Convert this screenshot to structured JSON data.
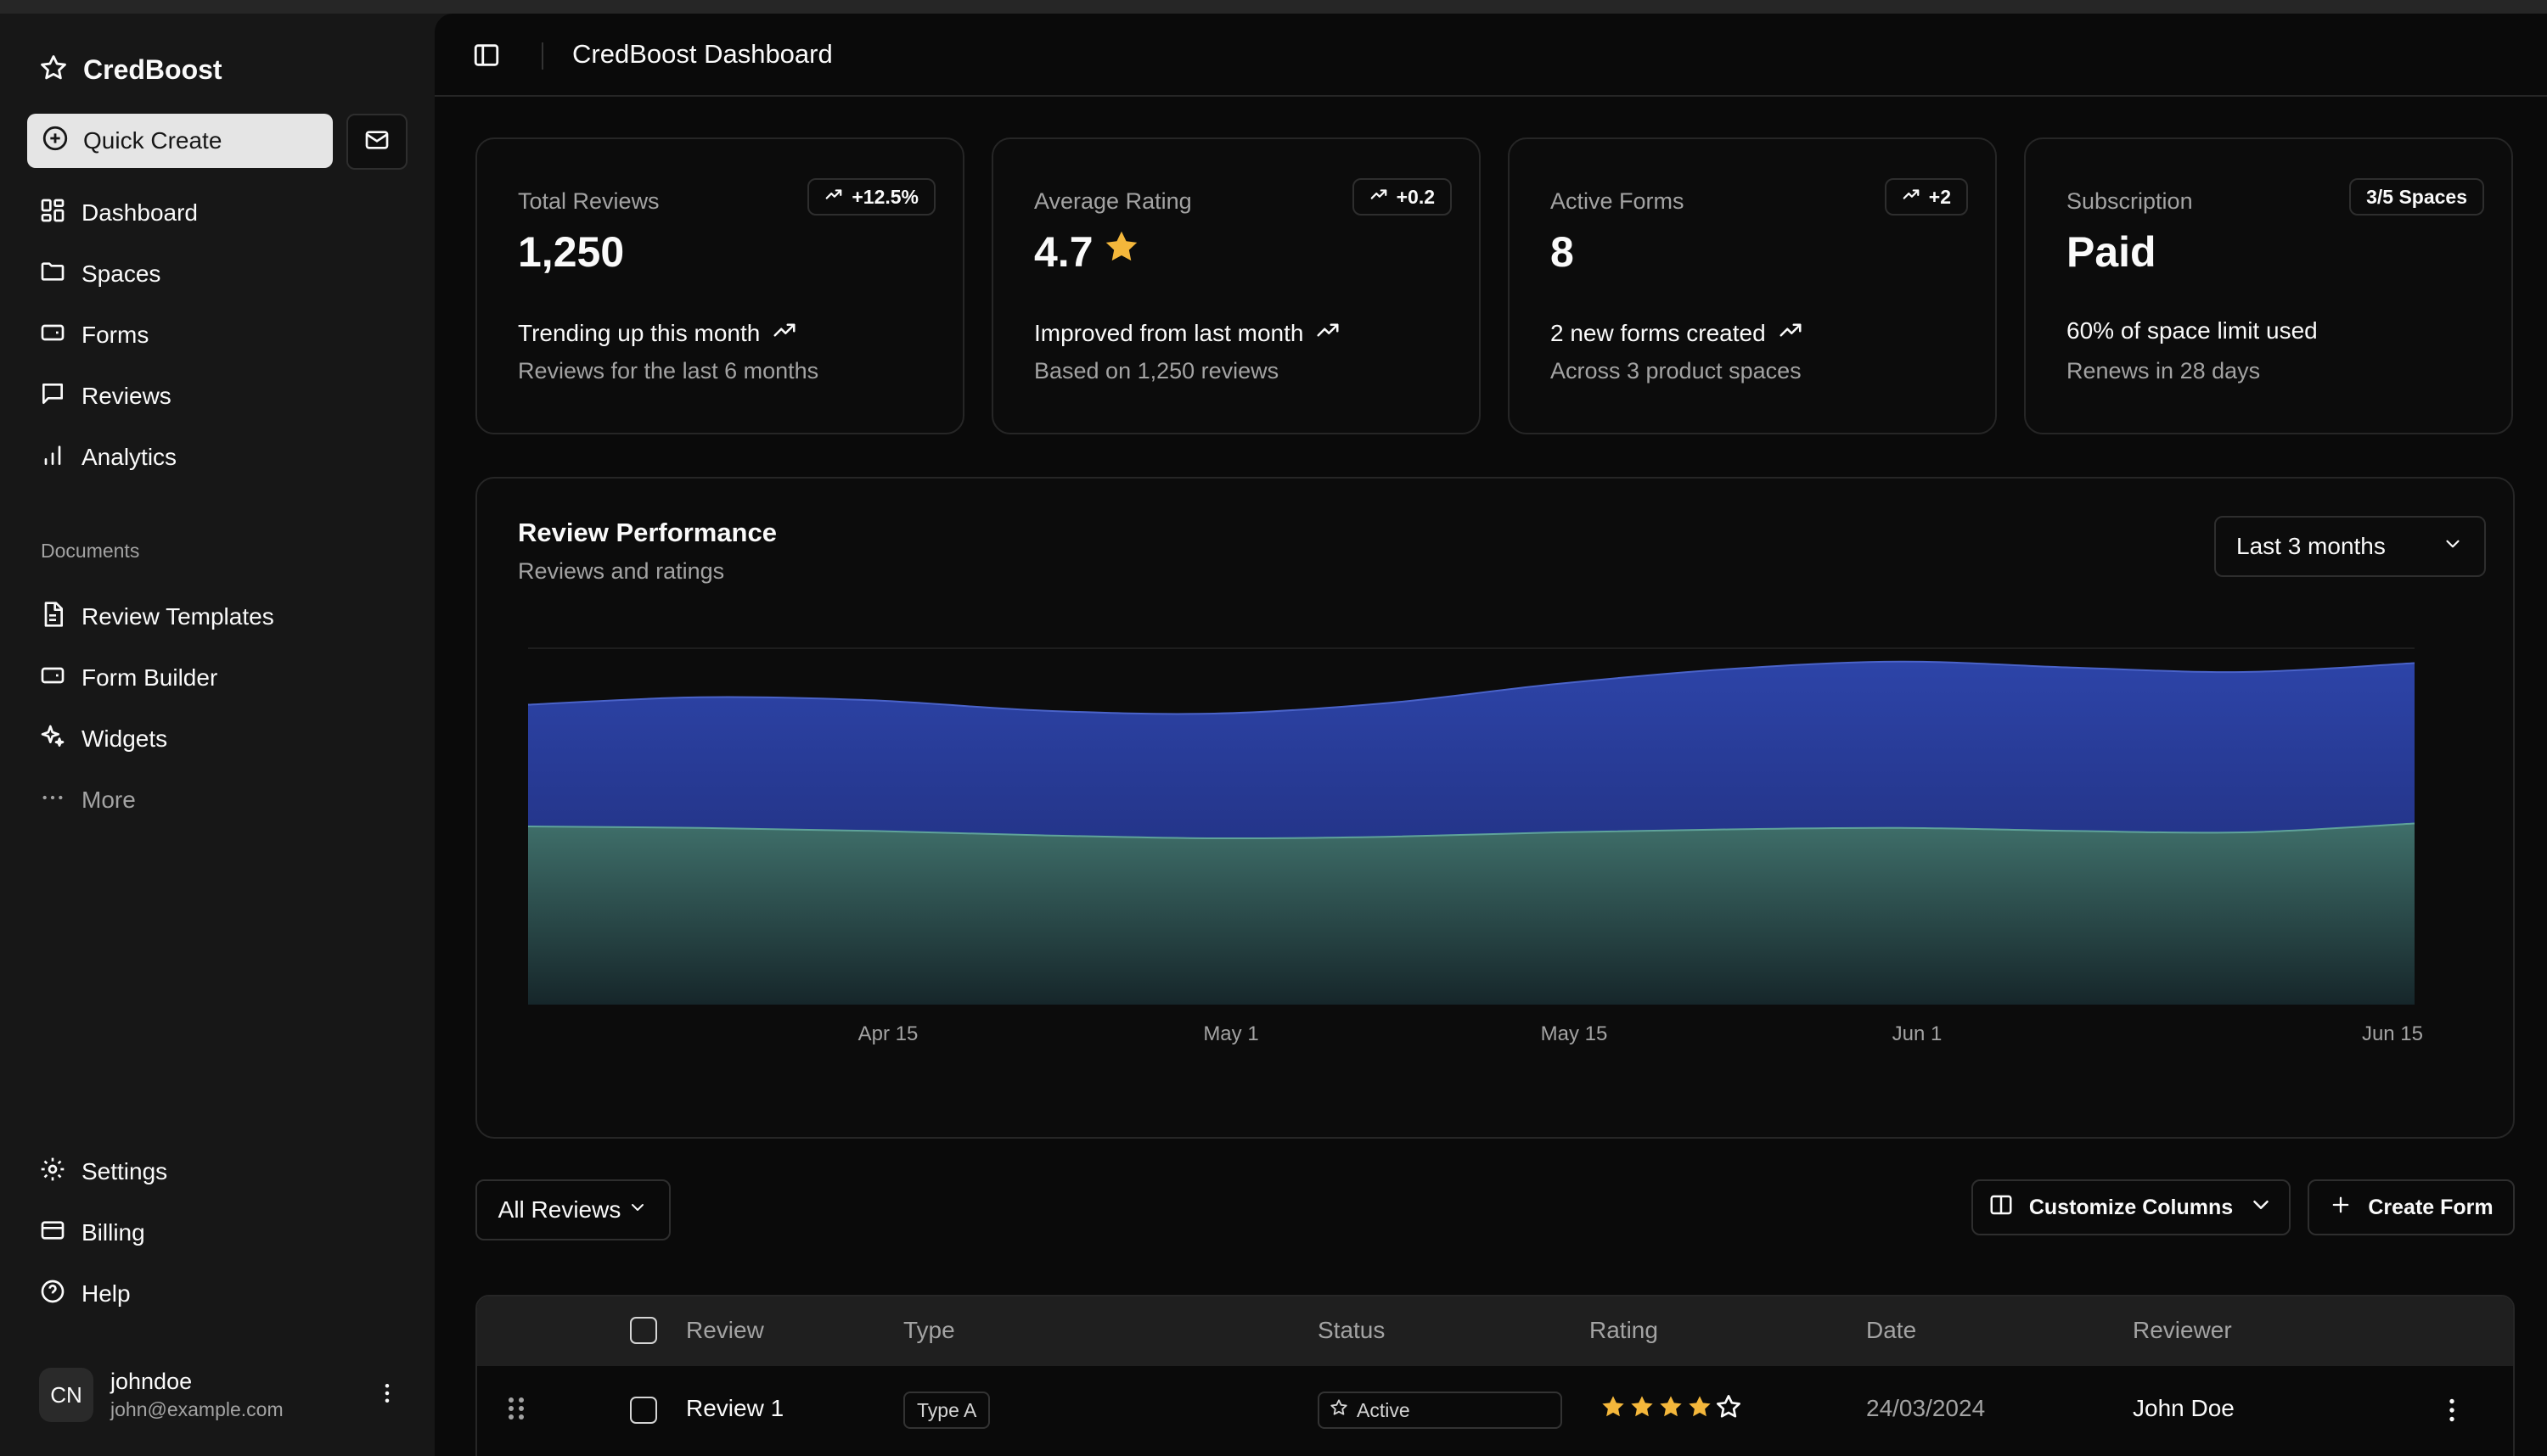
{
  "app": {
    "name": "CredBoost",
    "quick_create": "Quick Create",
    "page_title": "CredBoost Dashboard"
  },
  "sidebar": {
    "main_items": [
      {
        "label": "Dashboard",
        "icon": "dashboard-icon"
      },
      {
        "label": "Spaces",
        "icon": "folder-icon"
      },
      {
        "label": "Forms",
        "icon": "form-icon"
      },
      {
        "label": "Reviews",
        "icon": "message-icon"
      },
      {
        "label": "Analytics",
        "icon": "bar-chart-icon"
      }
    ],
    "documents_label": "Documents",
    "documents_items": [
      {
        "label": "Review Templates",
        "icon": "file-text-icon"
      },
      {
        "label": "Form Builder",
        "icon": "form-icon"
      },
      {
        "label": "Widgets",
        "icon": "sparkles-icon"
      },
      {
        "label": "More",
        "icon": "more-horizontal-icon"
      }
    ],
    "bottom_items": [
      {
        "label": "Settings",
        "icon": "gear-icon"
      },
      {
        "label": "Billing",
        "icon": "credit-card-icon"
      },
      {
        "label": "Help",
        "icon": "help-circle-icon"
      }
    ],
    "user": {
      "initials": "CN",
      "name": "johndoe",
      "email": "john@example.com"
    }
  },
  "cards": [
    {
      "label": "Total Reviews",
      "badge": "+12.5%",
      "value": "1,250",
      "line1": "Trending up this month",
      "line2": "Reviews for the last 6 months"
    },
    {
      "label": "Average Rating",
      "badge": "+0.2",
      "value": "4.7",
      "line1": "Improved from last month",
      "line2": "Based on 1,250 reviews"
    },
    {
      "label": "Active Forms",
      "badge": "+2",
      "value": "8",
      "line1": "2 new forms created",
      "line2": "Across 3 product spaces"
    },
    {
      "label": "Subscription",
      "badge": "3/5 Spaces",
      "value": "Paid",
      "line1": "60% of space limit used",
      "line2": "Renews in 28 days"
    }
  ],
  "chart": {
    "title": "Review Performance",
    "subtitle": "Reviews and ratings",
    "range": "Last 3 months"
  },
  "chart_data": {
    "type": "area",
    "x_ticks": [
      "Apr 15",
      "May 1",
      "May 15",
      "Jun 1",
      "Jun 15"
    ],
    "x": [
      "Apr 1",
      "Apr 8",
      "Apr 15",
      "Apr 22",
      "May 1",
      "May 8",
      "May 15",
      "May 22",
      "Jun 1",
      "Jun 8",
      "Jun 15",
      "Jun 30"
    ],
    "stacked": true,
    "grid": true,
    "series": [
      {
        "key": "lower",
        "color": "#3f6f6a",
        "values": [
          60,
          59.5,
          58.5,
          57,
          56,
          56.5,
          58,
          59,
          59.5,
          58.5,
          58,
          61
        ]
      },
      {
        "key": "upper",
        "color": "#2b3f9c",
        "values": [
          41,
          44,
          44,
          42,
          42,
          45,
          50,
          54,
          56,
          55,
          54,
          54
        ]
      }
    ],
    "ylim": [
      0,
      120
    ]
  },
  "table": {
    "filter": "All Reviews",
    "customize": "Customize Columns",
    "create": "Create Form",
    "columns": [
      "Review",
      "Type",
      "Status",
      "Rating",
      "Date",
      "Reviewer"
    ],
    "rows": [
      {
        "review": "Review 1",
        "type": "Type A",
        "status": "Active",
        "rating": 4,
        "date": "24/03/2024",
        "reviewer": "John Doe"
      }
    ]
  },
  "colors": {
    "accent_star": "#f4b73b",
    "lower_area": "#3f6f6a",
    "upper_area": "#2b3f9c"
  }
}
